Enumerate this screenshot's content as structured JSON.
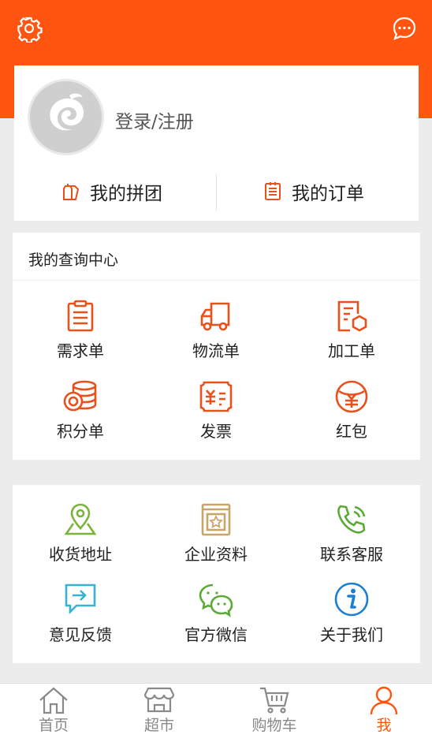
{
  "header": {
    "settings_icon": "gear-icon",
    "message_icon": "chat-bubble-icon",
    "color": "#ff5511"
  },
  "profile": {
    "login_label": "登录/注册",
    "group_buy_label": "我的拼团",
    "orders_label": "我的订单"
  },
  "query_center": {
    "title": "我的查询中心",
    "items": [
      {
        "label": "需求单",
        "icon": "clipboard-icon"
      },
      {
        "label": "物流单",
        "icon": "truck-icon"
      },
      {
        "label": "加工单",
        "icon": "document-hexagon-icon"
      },
      {
        "label": "积分单",
        "icon": "coins-icon"
      },
      {
        "label": "发票",
        "icon": "invoice-icon"
      },
      {
        "label": "红包",
        "icon": "red-packet-icon"
      }
    ]
  },
  "services": {
    "items": [
      {
        "label": "收货地址",
        "icon": "map-pin-icon"
      },
      {
        "label": "企业资料",
        "icon": "company-book-icon"
      },
      {
        "label": "联系客服",
        "icon": "phone-icon"
      },
      {
        "label": "意见反馈",
        "icon": "feedback-icon"
      },
      {
        "label": "官方微信",
        "icon": "wechat-icon"
      },
      {
        "label": "关于我们",
        "icon": "info-icon"
      }
    ]
  },
  "tabbar": {
    "items": [
      {
        "label": "首页",
        "icon": "home-icon",
        "active": false
      },
      {
        "label": "超市",
        "icon": "store-icon",
        "active": false
      },
      {
        "label": "购物车",
        "icon": "cart-icon",
        "active": false
      },
      {
        "label": "我",
        "icon": "person-icon",
        "active": true
      }
    ],
    "active_color": "#ff5511"
  }
}
